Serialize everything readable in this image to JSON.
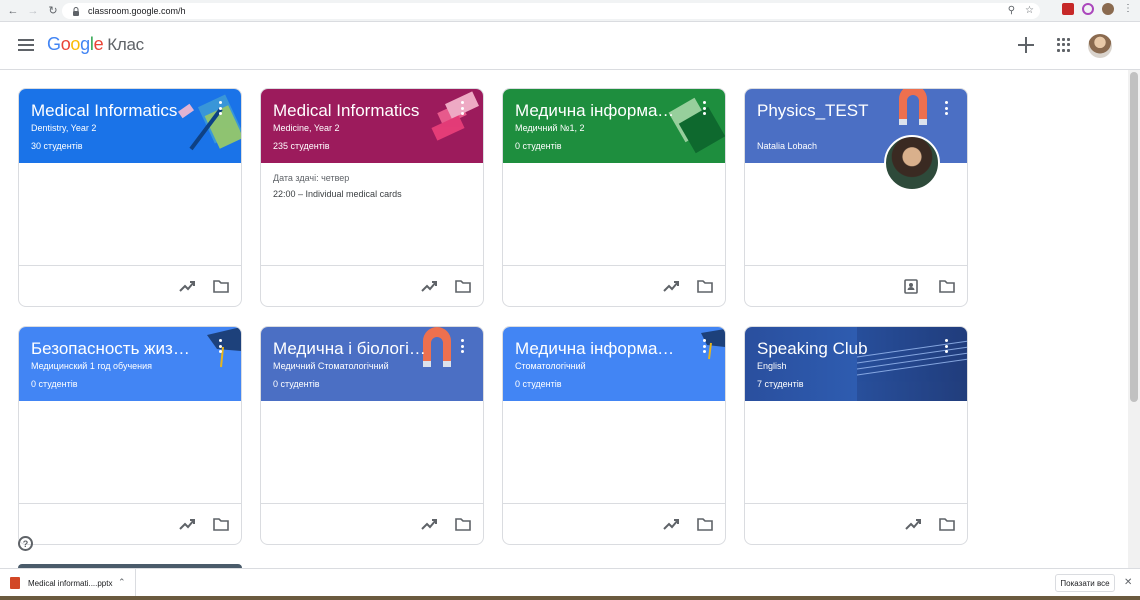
{
  "browser": {
    "url": "classroom.google.com/h",
    "back_icon": "arrow-left-icon",
    "forward_icon": "arrow-right-icon",
    "reload_icon": "reload-icon"
  },
  "header": {
    "logo_google": [
      "G",
      "o",
      "o",
      "g",
      "l",
      "e"
    ],
    "product_name": "Клас"
  },
  "cards": [
    {
      "title": "Medical Informatics",
      "subtitle": "Dentistry, Year 2",
      "count": "30 студентів",
      "color": "#1a73e8",
      "body_due": "",
      "body_task": ""
    },
    {
      "title": "Medical Informatics",
      "subtitle": "Medicine, Year 2",
      "count": "235 студентів",
      "color": "#9c1b5c",
      "body_due": "Дата здачі: четвер",
      "body_task": "22:00 – Individual medical cards"
    },
    {
      "title": "Медична інформати…",
      "subtitle": "Медичний №1, 2",
      "count": "0 студентів",
      "color": "#1e8e3e",
      "body_due": "",
      "body_task": ""
    },
    {
      "title": "Physics_TEST",
      "subtitle": "",
      "count": "Natalia Lobach",
      "color": "#4b6fc4",
      "body_due": "",
      "body_task": ""
    },
    {
      "title": "Безопасность жизн…",
      "subtitle": "Медицинский 1 год обучения",
      "count": "0 студентів",
      "color": "#4285f4",
      "body_due": "",
      "body_task": ""
    },
    {
      "title": "Медична і біологічн…",
      "subtitle": "Медичний Стоматологічний",
      "count": "0 студентів",
      "color": "#4b6fc4",
      "body_due": "",
      "body_task": ""
    },
    {
      "title": "Медична інформати…",
      "subtitle": "Стоматологічний",
      "count": "0 студентів",
      "color": "#4285f4",
      "body_due": "",
      "body_task": ""
    },
    {
      "title": "Speaking Club",
      "subtitle": "English",
      "count": "7 студентів",
      "color": "#2a4f9e",
      "body_due": "",
      "body_task": ""
    }
  ],
  "footer_help": "?",
  "download": {
    "file_name": "Medical informati....pptx",
    "show_all": "Показати все",
    "close": "✕"
  }
}
